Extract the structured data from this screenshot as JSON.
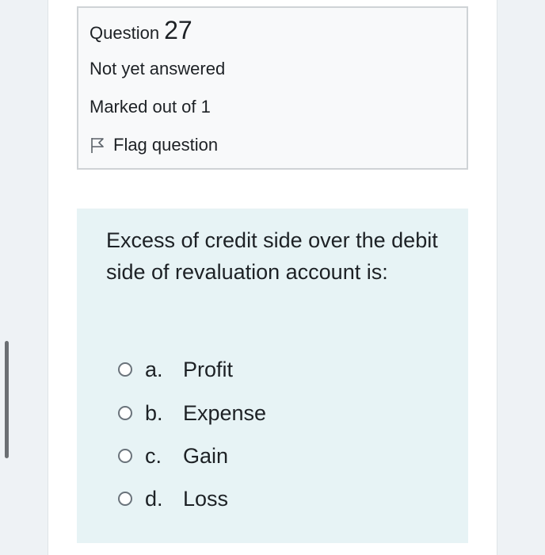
{
  "question": {
    "label": "Question",
    "number": "27",
    "state": "Not yet answered",
    "grade": "Marked out of 1",
    "flag_label": "Flag question",
    "text": "Excess of credit side over the debit side of revaluation account is:",
    "options": [
      {
        "letter": "a.",
        "text": "Profit"
      },
      {
        "letter": "b.",
        "text": "Expense"
      },
      {
        "letter": "c.",
        "text": "Gain"
      },
      {
        "letter": "d.",
        "text": "Loss"
      }
    ]
  },
  "colors": {
    "info_bg": "#f8f9fa",
    "content_bg": "#e7f3f5",
    "text": "#1d2125"
  }
}
